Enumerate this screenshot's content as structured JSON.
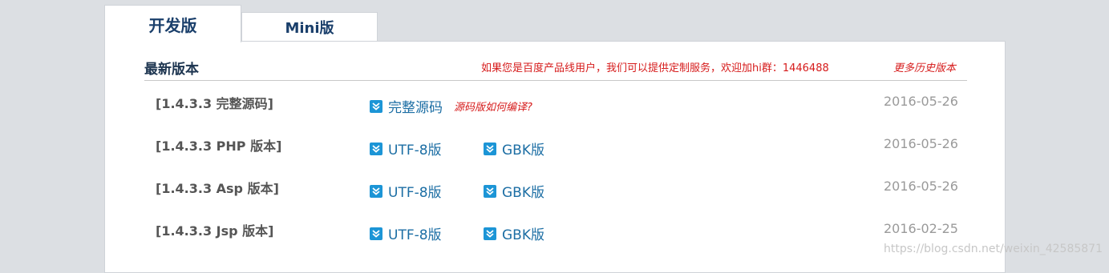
{
  "tabs": {
    "active": "开发版",
    "inactive": "Mini版"
  },
  "section": {
    "title": "最新版本",
    "notice": "如果您是百度产品线用户，我们可以提供定制服务，欢迎加hi群：1446488",
    "history_link": "更多历史版本"
  },
  "rows": [
    {
      "label": "[1.4.3.3 完整源码]",
      "link1": "完整源码",
      "hint": "源码版如何编译?",
      "date": "2016-05-26"
    },
    {
      "label": "[1.4.3.3 PHP 版本]",
      "link1": "UTF-8版",
      "link2": "GBK版",
      "date": "2016-05-26"
    },
    {
      "label": "[1.4.3.3 Asp 版本]",
      "link1": "UTF-8版",
      "link2": "GBK版",
      "date": "2016-05-26"
    },
    {
      "label": "[1.4.3.3 Jsp 版本]",
      "link1": "UTF-8版",
      "link2": "GBK版",
      "date": "2016-02-25"
    }
  ],
  "icons": {
    "download": "double-chevron-down-icon"
  },
  "colors": {
    "accent_red": "#d61b1b",
    "link_blue": "#1c6ea4",
    "icon_blue": "#1c95d6",
    "title_navy": "#1a3f6b"
  },
  "watermark": "https://blog.csdn.net/weixin_42585871"
}
